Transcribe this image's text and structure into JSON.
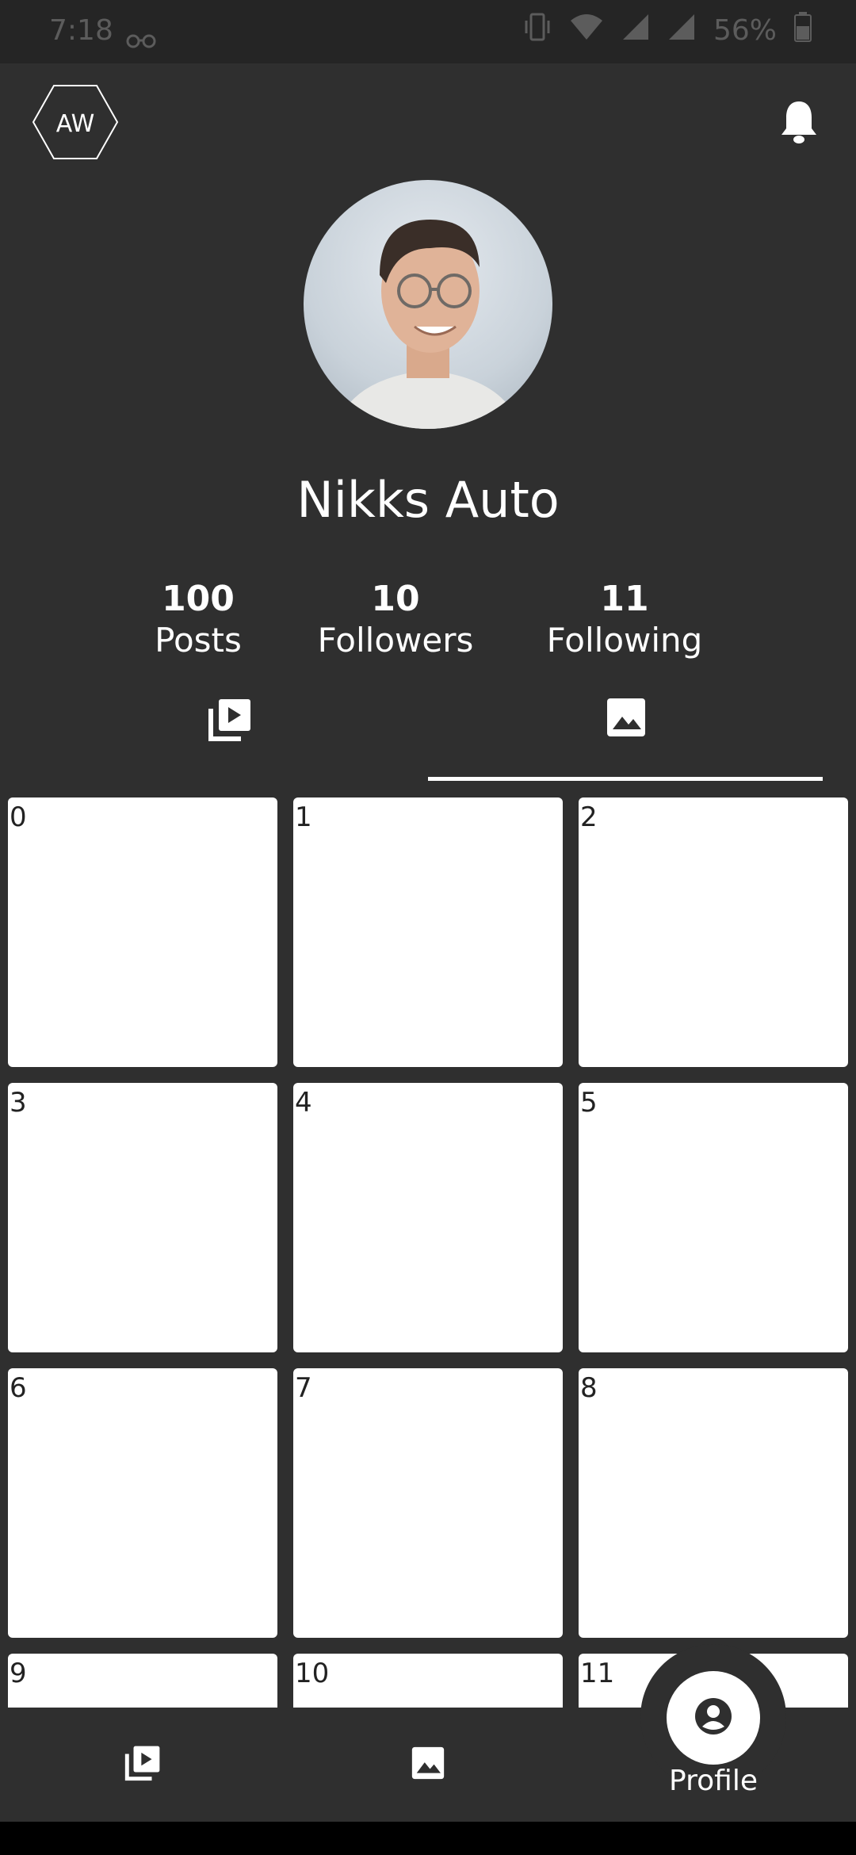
{
  "status_bar": {
    "time": "7:18",
    "battery_percent": "56%",
    "icons": [
      "glasses-icon",
      "vibrate-icon",
      "wifi-icon",
      "signal-icon",
      "signal-icon",
      "battery-icon"
    ]
  },
  "header": {
    "logo_text": "AW",
    "notification_icon": "bell-icon"
  },
  "profile": {
    "name": "Nikks Auto",
    "stats": [
      {
        "value": "100",
        "label": "Posts"
      },
      {
        "value": "10",
        "label": "Followers"
      },
      {
        "value": "11",
        "label": "Following"
      }
    ]
  },
  "tabs": [
    {
      "icon": "video-library-icon",
      "selected": false
    },
    {
      "icon": "image-icon",
      "selected": true
    }
  ],
  "grid_items": [
    "0",
    "1",
    "2",
    "3",
    "4",
    "5",
    "6",
    "7",
    "8",
    "9",
    "10",
    "11"
  ],
  "bottom_nav": {
    "items": [
      {
        "icon": "video-library-icon"
      },
      {
        "icon": "image-icon"
      },
      {
        "icon": "account-icon",
        "label": "Profile",
        "active": true
      }
    ]
  },
  "colors": {
    "background": "#2f2f2f",
    "status_bar": "#252525",
    "text": "#ffffff",
    "tile": "#ffffff"
  }
}
